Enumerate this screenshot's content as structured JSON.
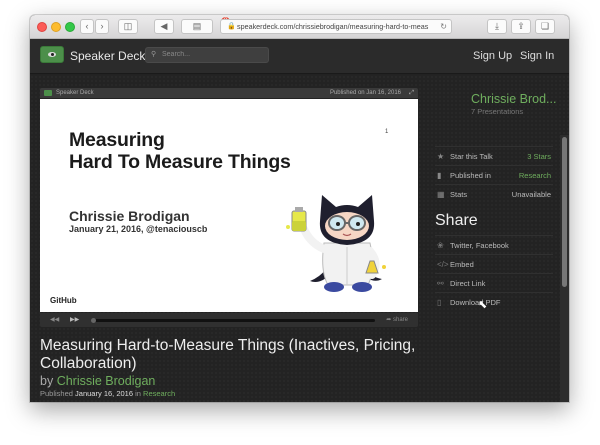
{
  "browser": {
    "url": "speakerdeck.com/chrissiebrodigan/measuring-hard-to-meas",
    "badge_count": "8",
    "icons": [
      "back-icon",
      "forward-icon",
      "sidebar-icon",
      "lock-icon",
      "reload-icon",
      "download-icon",
      "share-icon",
      "tabs-icon"
    ]
  },
  "navbar": {
    "brand": "Speaker Deck",
    "search_placeholder": "Search...",
    "sign_up": "Sign Up",
    "sign_in": "Sign In"
  },
  "player": {
    "brand": "Speaker Deck",
    "published": "Published on Jan 16, 2016",
    "share": "share",
    "slide": {
      "title_line1": "Measuring",
      "title_line2": "Hard To Measure Things",
      "page_number": "1",
      "author": "Chrissie Brodigan",
      "date": "January 21, 2016, @tenaciouscb",
      "footer_logo": "GitHub"
    }
  },
  "talk": {
    "title": "Measuring Hard-to-Measure Things (Inactives, Pricing, Collaboration)",
    "by": "by",
    "author": "Chrissie Brodigan",
    "published_label": "Published",
    "published_date": "January 16, 2016",
    "in": "in",
    "category": "Research"
  },
  "sidebar": {
    "author_name": "Chrissie Brod...",
    "presentations": "7 Presentations",
    "stats": [
      {
        "icon": "star-icon",
        "label": "Star this Talk",
        "value": "3 Stars"
      },
      {
        "icon": "bookmark-icon",
        "label": "Published in",
        "value": "Research"
      },
      {
        "icon": "stats-icon",
        "label": "Stats",
        "value": "Unavailable"
      }
    ],
    "share_heading": "Share",
    "share_items": [
      {
        "icon": "twitter-icon",
        "label": "Twitter, Facebook"
      },
      {
        "icon": "embed-icon",
        "label": "Embed"
      },
      {
        "icon": "link-icon",
        "label": "Direct Link"
      },
      {
        "icon": "pdf-icon",
        "label": "Download PDF"
      }
    ]
  },
  "colors": {
    "accent_green": "#6fae5e",
    "background": "#232323"
  }
}
